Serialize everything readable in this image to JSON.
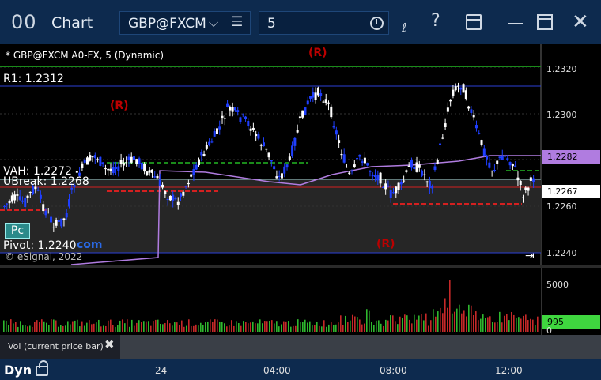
{
  "titlebar": {
    "app_icon": "00",
    "title": "Chart",
    "symbol": "GBP@FXCM",
    "interval": "5",
    "icons": [
      "chevron-down-icon",
      "menu-icon",
      "clock-icon",
      "draw-icon",
      "help-icon",
      "layout-icon",
      "minimize-icon",
      "maximize-icon",
      "close-icon"
    ]
  },
  "chart": {
    "header": "* GBP@FXCM A0-FX, 5 (Dynamic)",
    "r_marks": [
      "(R)",
      "(R)",
      "(R)"
    ],
    "levels": {
      "r1": "R1: 1.2312",
      "vah": "VAH: 1.2272",
      "ubreak": "UBreak: 1.2268",
      "pivot": "Pivot: 1.2240"
    },
    "pc_button": "Pc",
    "com_text": "com",
    "copyright": "© eSignal, 2022",
    "jump_icon": "⇥"
  },
  "price_axis": {
    "ticks": [
      "1.2320",
      "1.2300",
      "1.2260",
      "1.2240"
    ],
    "purple_label": "1.2282",
    "price_label": "1.2267"
  },
  "volume_axis": {
    "ticks": [
      "5000",
      "0"
    ],
    "current": "995"
  },
  "study_strip": {
    "label": "Vol (current price bar)",
    "close": "✖"
  },
  "timebar": {
    "mode": "Dyn",
    "ticks": [
      "24",
      "04:00",
      "08:00",
      "12:00"
    ]
  },
  "colors": {
    "up": "#ffffff",
    "down": "#1f3fff",
    "r1": "#2b3fd6",
    "vah": "#9cc",
    "ubreak": "#d42020",
    "vwap": "#b07ce0",
    "green_line": "#1a8a1a",
    "vol_up": "#2eb82e",
    "vol_down": "#c62828"
  }
}
